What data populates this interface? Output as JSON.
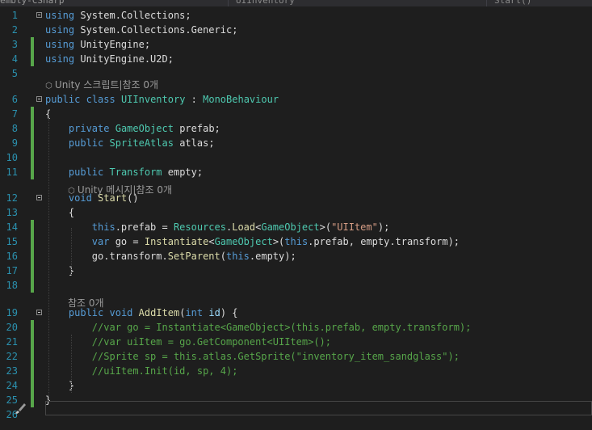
{
  "tabs": [
    "embly-CSharp",
    "UIInventory",
    "Start()"
  ],
  "colors": {
    "keyword": "#569cd6",
    "type": "#4ec9b0",
    "method": "#dcdcaa",
    "string": "#d69d85",
    "comment": "#57a64a",
    "line_number": "#2b91af",
    "change_bar": "#57a64a"
  },
  "code_lens": {
    "unity_script": "Unity 스크립트|참조 0개",
    "unity_message": "Unity 메시지|참조 0개",
    "refs": "참조 0개"
  },
  "lines": [
    {
      "n": "1",
      "tokens": [
        {
          "c": "k",
          "v": "using"
        },
        {
          "v": " System.Collections;"
        }
      ]
    },
    {
      "n": "2",
      "tokens": [
        {
          "c": "k",
          "v": "using"
        },
        {
          "v": " System.Collections.Generic;"
        }
      ]
    },
    {
      "n": "3",
      "tokens": [
        {
          "c": "k",
          "v": "using"
        },
        {
          "v": " UnityEngine;"
        }
      ]
    },
    {
      "n": "4",
      "tokens": [
        {
          "c": "k",
          "v": "using"
        },
        {
          "v": " UnityEngine.U2D;"
        }
      ]
    },
    {
      "n": "5",
      "tokens": []
    },
    {
      "n": "6",
      "tokens": [
        {
          "c": "k",
          "v": "public"
        },
        {
          "v": " "
        },
        {
          "c": "k",
          "v": "class"
        },
        {
          "v": " "
        },
        {
          "c": "t",
          "v": "UIInventory"
        },
        {
          "v": " : "
        },
        {
          "c": "t",
          "v": "MonoBehaviour"
        }
      ]
    },
    {
      "n": "7",
      "tokens": [
        {
          "v": "{"
        }
      ]
    },
    {
      "n": "8",
      "tokens": [
        {
          "v": "    "
        },
        {
          "c": "k",
          "v": "private"
        },
        {
          "v": " "
        },
        {
          "c": "t",
          "v": "GameObject"
        },
        {
          "v": " prefab;"
        }
      ]
    },
    {
      "n": "9",
      "tokens": [
        {
          "v": "    "
        },
        {
          "c": "k",
          "v": "public"
        },
        {
          "v": " "
        },
        {
          "c": "t",
          "v": "SpriteAtlas"
        },
        {
          "v": " atlas;"
        }
      ]
    },
    {
      "n": "10",
      "tokens": []
    },
    {
      "n": "11",
      "tokens": [
        {
          "v": "    "
        },
        {
          "c": "k",
          "v": "public"
        },
        {
          "v": " "
        },
        {
          "c": "t",
          "v": "Transform"
        },
        {
          "v": " empty;"
        }
      ]
    },
    {
      "n": "12",
      "tokens": [
        {
          "v": "    "
        },
        {
          "c": "k",
          "v": "void"
        },
        {
          "v": " "
        },
        {
          "c": "m",
          "v": "Start"
        },
        {
          "v": "()"
        }
      ]
    },
    {
      "n": "13",
      "tokens": [
        {
          "v": "    {"
        }
      ]
    },
    {
      "n": "14",
      "tokens": [
        {
          "v": "        "
        },
        {
          "c": "k",
          "v": "this"
        },
        {
          "v": ".prefab = "
        },
        {
          "c": "t",
          "v": "Resources"
        },
        {
          "v": "."
        },
        {
          "c": "m",
          "v": "Load"
        },
        {
          "v": "<"
        },
        {
          "c": "t",
          "v": "GameObject"
        },
        {
          "v": ">("
        },
        {
          "c": "s",
          "v": "\"UIItem\""
        },
        {
          "v": ");"
        }
      ]
    },
    {
      "n": "15",
      "tokens": [
        {
          "v": "        "
        },
        {
          "c": "k",
          "v": "var"
        },
        {
          "v": " go = "
        },
        {
          "c": "m",
          "v": "Instantiate"
        },
        {
          "v": "<"
        },
        {
          "c": "t",
          "v": "GameObject"
        },
        {
          "v": ">("
        },
        {
          "c": "k",
          "v": "this"
        },
        {
          "v": ".prefab, empty.transform);"
        }
      ]
    },
    {
      "n": "16",
      "tokens": [
        {
          "v": "        go.transform."
        },
        {
          "c": "m",
          "v": "SetParent"
        },
        {
          "v": "("
        },
        {
          "c": "k",
          "v": "this"
        },
        {
          "v": ".empty);"
        }
      ]
    },
    {
      "n": "17",
      "tokens": [
        {
          "v": "    }"
        }
      ]
    },
    {
      "n": "18",
      "tokens": []
    },
    {
      "n": "19",
      "tokens": [
        {
          "v": "    "
        },
        {
          "c": "k",
          "v": "public"
        },
        {
          "v": " "
        },
        {
          "c": "k",
          "v": "void"
        },
        {
          "v": " "
        },
        {
          "c": "m",
          "v": "AddItem"
        },
        {
          "v": "("
        },
        {
          "c": "k",
          "v": "int"
        },
        {
          "v": " "
        },
        {
          "c": "p",
          "v": "id"
        },
        {
          "v": ") {"
        }
      ]
    },
    {
      "n": "20",
      "tokens": [
        {
          "v": "        "
        },
        {
          "c": "c",
          "v": "//var go = Instantiate<GameObject>(this.prefab, empty.transform);"
        }
      ]
    },
    {
      "n": "21",
      "tokens": [
        {
          "v": "        "
        },
        {
          "c": "c",
          "v": "//var uiItem = go.GetComponent<UIItem>();"
        }
      ]
    },
    {
      "n": "22",
      "tokens": [
        {
          "v": "        "
        },
        {
          "c": "c",
          "v": "//Sprite sp = this.atlas.GetSprite(\"inventory_item_sandglass\");"
        }
      ]
    },
    {
      "n": "23",
      "tokens": [
        {
          "v": "        "
        },
        {
          "c": "c",
          "v": "//uiItem.Init(id, sp, 4);"
        }
      ]
    },
    {
      "n": "24",
      "tokens": [
        {
          "v": "    }"
        }
      ]
    },
    {
      "n": "25",
      "tokens": [
        {
          "v": "}"
        }
      ]
    },
    {
      "n": "26",
      "tokens": []
    }
  ]
}
